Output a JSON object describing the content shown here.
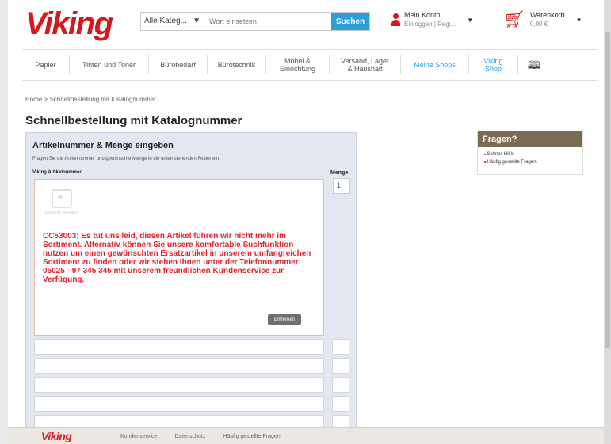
{
  "header": {
    "logo": "Viking",
    "search": {
      "category": "Alle Kateg...",
      "placeholder": "Wort einsetzen",
      "button": "Suchen"
    },
    "account": {
      "label": "Mein Konto",
      "sub": "Einloggen | Regi..."
    },
    "cart": {
      "label": "Warenkorb",
      "sub": "0,00 €"
    }
  },
  "nav": {
    "items": [
      "Papier",
      "Tinten und Toner",
      "Bürobedarf",
      "Bürotechnik",
      "Möbel & Einrichtung",
      "Versand, Lager & Haushalt",
      "Meine Shops",
      "Viking Shop"
    ]
  },
  "breadcrumb": "Home > Schnellbestellung mit Katalognummer",
  "page_title": "Schnellbestellung mit Katalognummer",
  "panel": {
    "heading": "Artikelnummer & Menge eingeben",
    "description": "Fragen Sie die Artikelnummer und gewünschte Menge in die unten stehenden Felder ein.",
    "col_article": "Viking Artikelnummer",
    "col_qty": "Menge",
    "first_qty": "1",
    "no_image_label": "Bild nicht verfügbar",
    "error_message": "CC53003: Es tut uns leid, diesen Artikel führen wir nicht mehr im Sortiment. Alternativ können Sie unsere komfortable Suchfunktion nutzen um einen gewünschten Ersatzartikel in unserem umfangreichen Sortiment zu finden oder wir stehen Ihnen unter der Telefonnummer 05025 - 97 345 345 mit unserem freundlichen Kundenservice zur Verfügung.",
    "remove_button": "Entfernen"
  },
  "sidebar": {
    "title": "Fragen?",
    "links": [
      "Schnell Hilfe",
      "Häufig gestellte Fragen"
    ]
  },
  "footer": {
    "logo": "Viking",
    "links": [
      "Kundenservice",
      "Datenschutz",
      "Häufig gestellte Fragen"
    ]
  },
  "colors": {
    "brand_red": "#d5171e",
    "search_blue": "#2a9fd8",
    "panel_bg": "#e3e8f0",
    "sidebar_head": "#7d6a55",
    "error_red": "#e4222a"
  }
}
